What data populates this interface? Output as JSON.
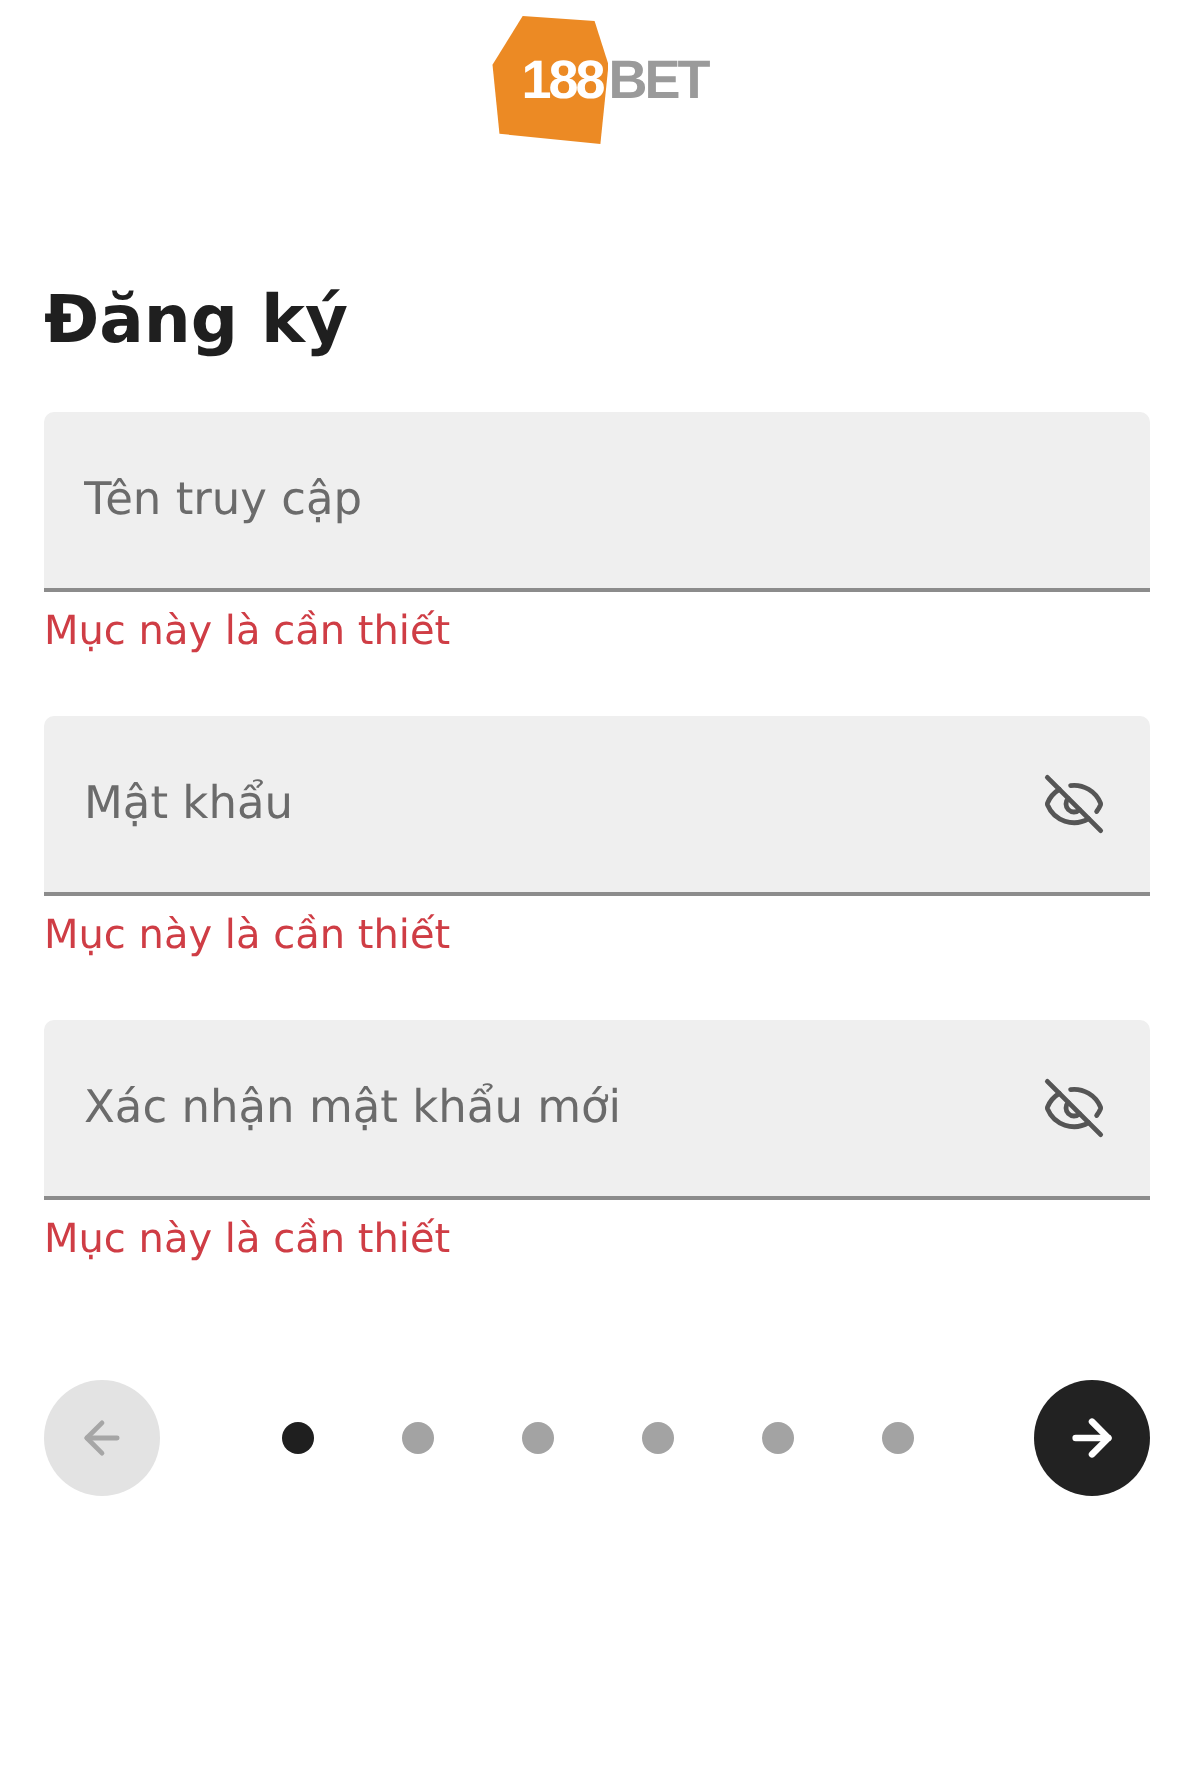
{
  "logo": {
    "badge": "188",
    "word": "BET"
  },
  "title": "Đăng ký",
  "fields": [
    {
      "kind": "text",
      "placeholder": "Tên truy cập",
      "error": "Mục này là cần thiết"
    },
    {
      "kind": "password",
      "placeholder": "Mật khẩu",
      "error": "Mục này là cần thiết"
    },
    {
      "kind": "password",
      "placeholder": "Xác nhận mật khẩu mới",
      "error": "Mục này là cần thiết"
    }
  ],
  "pager": {
    "back_button": {
      "disabled": true
    },
    "steps": [
      {
        "selected": true
      },
      {
        "selected": false
      },
      {
        "selected": false
      },
      {
        "selected": false
      },
      {
        "selected": false
      },
      {
        "selected": false
      }
    ]
  }
}
